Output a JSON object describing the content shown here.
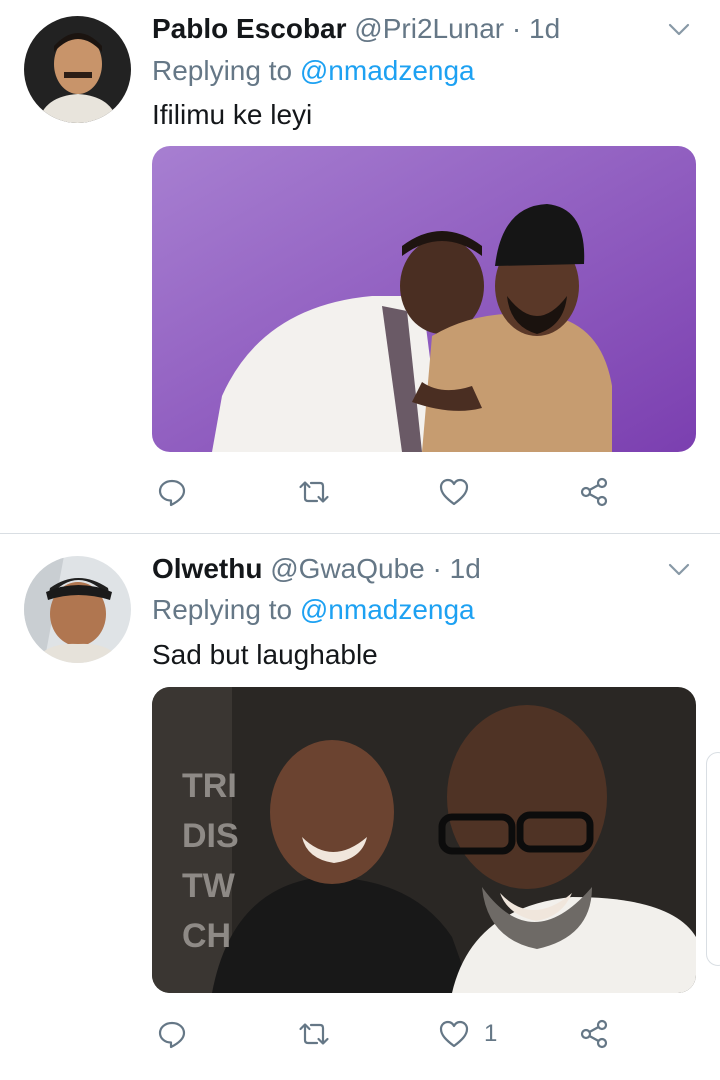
{
  "tweets": [
    {
      "name": "Pablo Escobar",
      "handle": "@Pri2Lunar",
      "separator": "·",
      "time": "1d",
      "replying_prefix": "Replying to",
      "replying_to": "@nmadzenga",
      "text": "Ifilimu  ke leyi",
      "like_count": "",
      "media_desc_icon": "photo-two-men-laughing-purple"
    },
    {
      "name": "Olwethu",
      "handle": "@GwaQube",
      "separator": "·",
      "time": "1d",
      "replying_prefix": "Replying to",
      "replying_to": "@nmadzenga",
      "text": "Sad but laughable",
      "like_count": "1",
      "media_desc_icon": "photo-two-men-laughing-studio"
    }
  ],
  "actions": [
    "reply-icon",
    "retweet-icon",
    "like-icon",
    "share-icon"
  ],
  "colors": {
    "link": "#1da1f2",
    "secondary_text": "#657786",
    "primary_text": "#14171a",
    "divider": "#d9dee3"
  }
}
